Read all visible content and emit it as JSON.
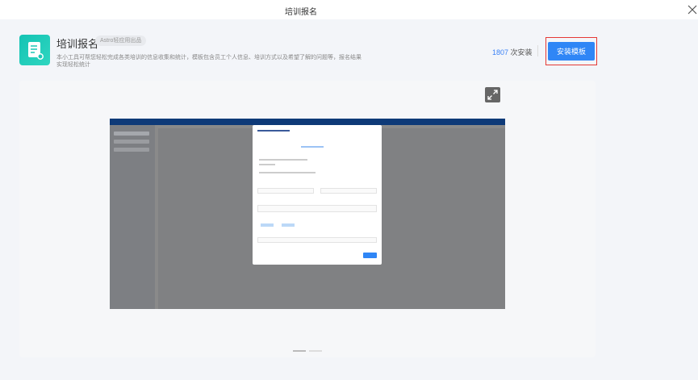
{
  "window": {
    "title": "培训报名"
  },
  "app": {
    "title": "培训报名",
    "badge": "Astro轻应用出品",
    "description": "本小工具可帮您轻松完成各类培训的信息收集和统计，模板包含员工个人信息、培训方式以及希望了解的问题等，报名结果实现轻松统计",
    "install_count": "1807",
    "install_suffix": " 次安装",
    "install_button": "安装模板"
  },
  "colors": {
    "accent": "#2f86f6",
    "highlight": "#e53935",
    "icon": "#14c3b4"
  }
}
